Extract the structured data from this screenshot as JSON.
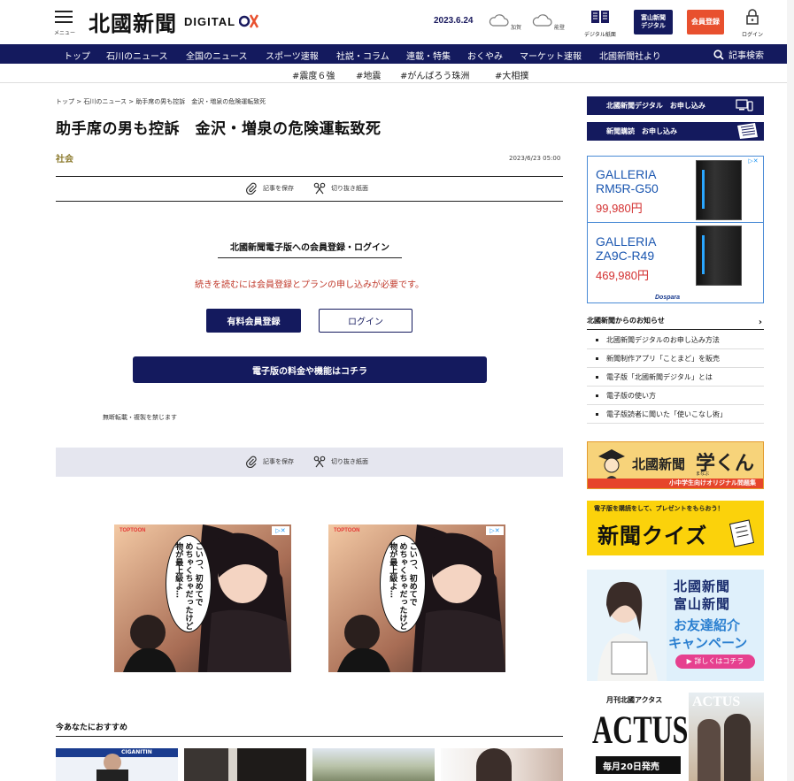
{
  "header": {
    "menu_label": "メニュー",
    "logo_jp": "北國新聞",
    "logo_digital": "DIGITAL",
    "date": "2023.6.24",
    "weather": [
      {
        "place": "加賀",
        "icon": "cloud-icon"
      },
      {
        "place": "能登",
        "icon": "cloud-icon"
      }
    ],
    "digital_paper_label": "デジタル紙面",
    "toyama_label_1": "富山新聞",
    "toyama_label_2": "デジタル",
    "register_label": "会員登録",
    "login_label": "ログイン",
    "colors": {
      "navy": "#141a5e",
      "register": "#e8502e"
    }
  },
  "nav": {
    "items": [
      "トップ",
      "石川のニュース",
      "全国のニュース",
      "スポーツ速報",
      "社説・コラム",
      "連載・特集",
      "おくやみ",
      "マーケット速報",
      "北國新聞社より"
    ],
    "search_label": "記事検索"
  },
  "tags": [
    "#震度６強",
    "#地震",
    "#がんばろう珠洲",
    "#大相撲"
  ],
  "article": {
    "breadcrumb": [
      "トップ",
      "石川のニュース",
      "助手席の男も控訴　金沢・増泉の危険運転致死"
    ],
    "headline": "助手席の男も控訴　金沢・増泉の危険運転致死",
    "category": "社会",
    "published": "2023/6/23 05:00",
    "save_label": "記事を保存",
    "clip_label": "切り抜き紙面",
    "login_title": "北國新聞電子版への会員登録・ログイン",
    "login_message": "続きを読むには会員登録とプランの申し込みが必要です。",
    "paid_register_label": "有料会員登録",
    "login_button_label": "ログイン",
    "pricing_label": "電子版の料金や機能はコチラ",
    "copyright": "無断転載・複製を禁じます"
  },
  "ads": {
    "manga_brand": "TOPTOON",
    "manga_text": "こいつ、初めてで\nめちゃくちゃだったけど\n物が最上級よ…"
  },
  "recommend": {
    "title": "今あなたにおすすめ",
    "thumb_text": "CIGANITIN"
  },
  "sidebar": {
    "subscribe_digital": "北國新聞デジタル　お申し込み",
    "subscribe_paper": "新聞購読　お申し込み",
    "pc_ad": {
      "items": [
        {
          "name_1": "GALLERIA",
          "name_2": "RM5R-G50",
          "price": "99,980円"
        },
        {
          "name_1": "GALLERIA",
          "name_2": "ZA9C-R49",
          "price": "469,980円"
        }
      ],
      "brand": "Dospara"
    },
    "notices_title": "北國新聞からのお知らせ",
    "notices": [
      "北國新聞デジタルのお申し込み方法",
      "新聞制作アプリ「ことまど」を販売",
      "電子版「北國新聞デジタル」とは",
      "電子版の使い方",
      "電子版読者に聞いた「使いこなし術」"
    ],
    "manabu": {
      "title": "北國新聞",
      "big": "学くん",
      "ruby": "まなぶ",
      "sub": "小中学生向けオリジナル問題集"
    },
    "quiz": {
      "top": "電子版を購読をして、プレゼントをもらおう！",
      "big": "新聞クイズ"
    },
    "friend": {
      "line1": "北國新聞",
      "line2": "富山新聞",
      "title_1": "お友達紹介",
      "title_2": "キャンペーン",
      "cta": "▶ 詳しくはコチラ"
    },
    "actus": {
      "top": "月刊北國アクタス",
      "big": "ACTUS",
      "sub": "毎月20日発売",
      "cover": "ACTUS"
    }
  }
}
